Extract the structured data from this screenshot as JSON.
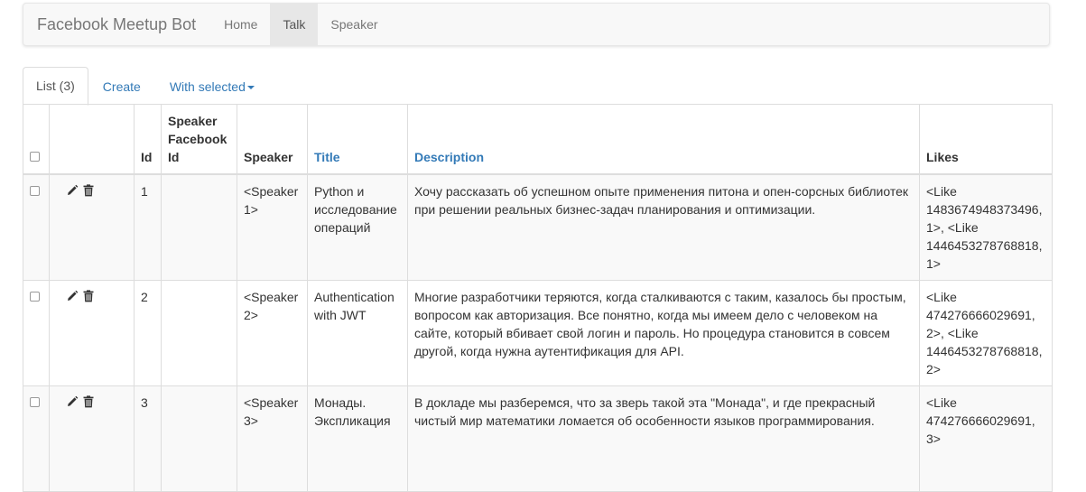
{
  "navbar": {
    "brand": "Facebook Meetup Bot",
    "links": [
      "Home",
      "Talk",
      "Speaker"
    ],
    "active": "Talk"
  },
  "tabs": {
    "list": "List (3)",
    "create": "Create",
    "with_selected": "With selected"
  },
  "table": {
    "headers": {
      "id": "Id",
      "speaker_facebook_id": "Speaker Facebook Id",
      "speaker": "Speaker",
      "title": "Title",
      "description": "Description",
      "likes": "Likes"
    },
    "rows": [
      {
        "id": "1",
        "speaker_facebook_id": "",
        "speaker": "<Speaker 1>",
        "title": "Python и исследование операций",
        "description": "Хочу рассказать об успешном опыте применения питона и опен-сорсных библиотек при решении реальных бизнес-задач планирования и оптимизации.",
        "likes": "<Like 1483674948373496, 1>, <Like 1446453278768818, 1>"
      },
      {
        "id": "2",
        "speaker_facebook_id": "",
        "speaker": "<Speaker 2>",
        "title": "Authentication with JWT",
        "description": "Многие разработчики теряются, когда сталкиваются с таким, казалось бы простым, вопросом как авторизация. Все понятно, когда мы имеем дело с человеком на сайте, который вбивает свой логин и пароль. Но процедура становится в совсем другой, когда нужна аутентификация для API.",
        "likes": "<Like 474276666029691, 2>, <Like 1446453278768818, 2>"
      },
      {
        "id": "3",
        "speaker_facebook_id": "",
        "speaker": "<Speaker 3>",
        "title": "Монады. Экспликация",
        "description": "В докладе мы разберемся, что за зверь такой эта \"Монада\", и где прекрасный чистый мир математики ломается об особенности языков программирования.",
        "likes": "<Like 474276666029691, 3>"
      }
    ]
  },
  "icons": {
    "edit": "pencil-icon",
    "delete": "trash-icon"
  },
  "colors": {
    "link": "#337ab7",
    "navbar_bg": "#f8f8f8",
    "active_nav": "#e7e7e7",
    "stripe": "#f9f9f9"
  }
}
